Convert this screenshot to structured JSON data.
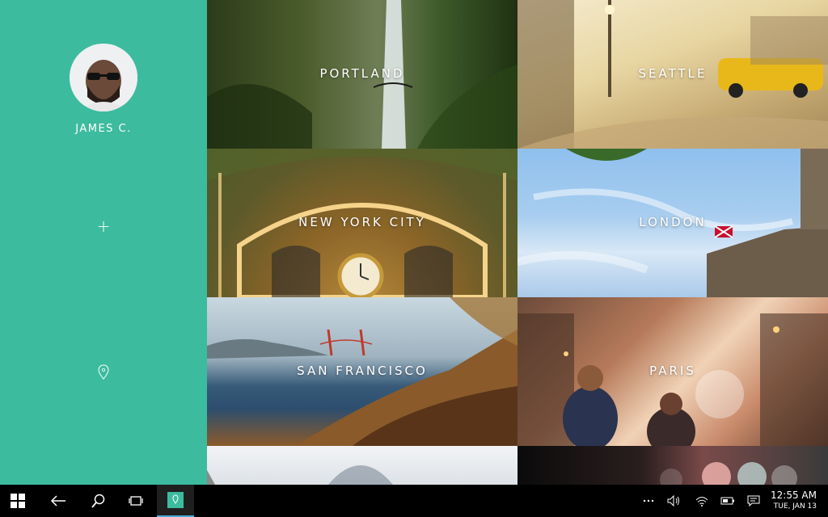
{
  "sidebar": {
    "user_name": "JAMES C.",
    "add_label": "+",
    "accent_color": "#3dbb9e"
  },
  "cities": [
    {
      "name": "PORTLAND"
    },
    {
      "name": "SEATTLE"
    },
    {
      "name": "NEW YORK CITY"
    },
    {
      "name": "LONDON"
    },
    {
      "name": "SAN FRANCISCO"
    },
    {
      "name": "PARIS"
    }
  ],
  "taskbar": {
    "start_icon": "windows-logo-icon",
    "back_icon": "back-arrow-icon",
    "search_icon": "search-icon",
    "task_view_icon": "task-view-icon",
    "app_icon": "pin-app-icon",
    "tray": {
      "overflow_icon": "more-icon",
      "volume_icon": "volume-icon",
      "wifi_icon": "wifi-icon",
      "battery_icon": "battery-icon",
      "notification_icon": "action-center-icon"
    },
    "time": "12:55 AM",
    "date": "TUE, JAN 13"
  }
}
